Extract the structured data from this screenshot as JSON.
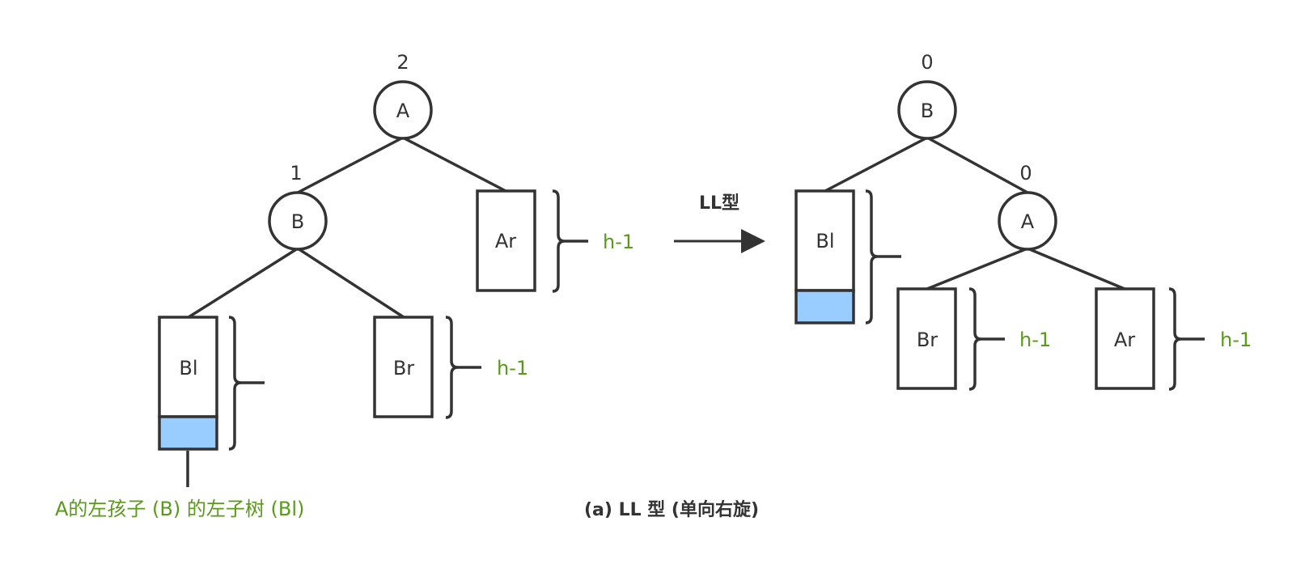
{
  "colors": {
    "stroke": "#333333",
    "highlight": "#99ccff",
    "green_text": "#5a9a1a"
  },
  "before": {
    "root_label": "A",
    "root_balance": "2",
    "left_label": "B",
    "left_balance": "1",
    "ar_label": "Ar",
    "bl_label": "Bl",
    "br_label": "Br",
    "ar_height": "h-1",
    "br_height": "h-1",
    "bl_note": "A的左孩子 (B) 的左子树 (Bl)"
  },
  "arrow_label": "LL型",
  "after": {
    "root_label": "B",
    "root_balance": "0",
    "right_label": "A",
    "right_balance": "0",
    "bl_label": "Bl",
    "br_label": "Br",
    "ar_label": "Ar",
    "br_height": "h-1",
    "ar_height": "h-1"
  },
  "caption": "(a) LL 型 (单向右旋)"
}
